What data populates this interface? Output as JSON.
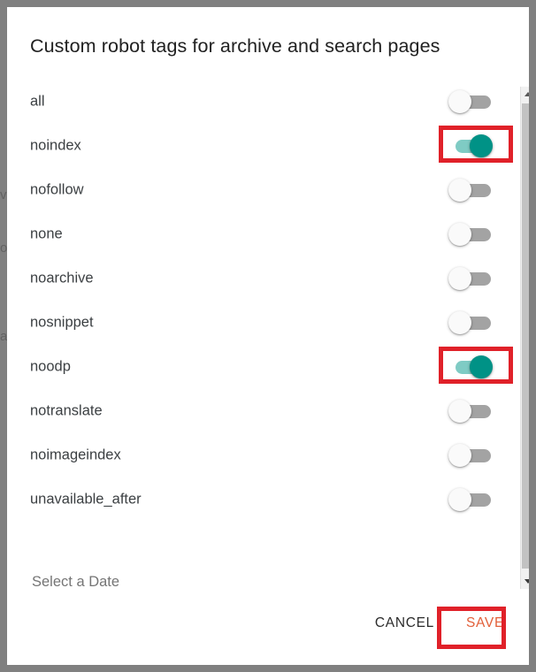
{
  "dialog": {
    "title": "Custom robot tags for archive and search pages",
    "rows": [
      {
        "label": "all",
        "state": "off",
        "highlighted": false
      },
      {
        "label": "noindex",
        "state": "on",
        "highlighted": true
      },
      {
        "label": "nofollow",
        "state": "off",
        "highlighted": false
      },
      {
        "label": "none",
        "state": "off",
        "highlighted": false
      },
      {
        "label": "noarchive",
        "state": "off",
        "highlighted": false
      },
      {
        "label": "nosnippet",
        "state": "off",
        "highlighted": false
      },
      {
        "label": "noodp",
        "state": "on",
        "highlighted": true
      },
      {
        "label": "notranslate",
        "state": "off",
        "highlighted": false
      },
      {
        "label": "noimageindex",
        "state": "off",
        "highlighted": false
      },
      {
        "label": "unavailable_after",
        "state": "off",
        "highlighted": false
      }
    ],
    "date_field": {
      "placeholder": "Select a Date",
      "value": ""
    },
    "actions": {
      "cancel_label": "CANCEL",
      "save_label": "SAVE",
      "save_highlighted": true
    }
  },
  "scrollbar": {
    "up_icon": "triangle-up-icon",
    "down_icon": "triangle-down-icon",
    "thumb_position_percent": 0
  },
  "background_fragments": [
    "v",
    "o",
    "a"
  ],
  "colors": {
    "toggle_on_thumb": "#009286",
    "toggle_on_track": "#7fcbc4",
    "toggle_off_track": "#a3a3a3",
    "toggle_off_thumb": "#fafafa",
    "highlight_box": "#e02129",
    "save_text": "#e2603a",
    "cancel_text": "#2b2b2b",
    "title_text": "#212121",
    "label_text": "#3c4043",
    "placeholder_text": "#9aa0a6",
    "backdrop": "#808080",
    "dialog_bg": "#ffffff"
  }
}
